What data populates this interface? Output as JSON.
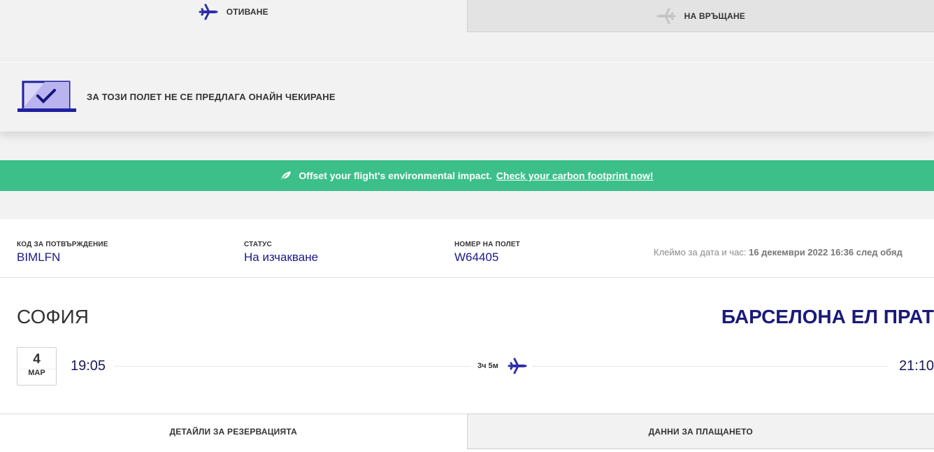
{
  "tabs": {
    "outbound": {
      "label": "ОТИВАНЕ",
      "icon": "plane-icon"
    },
    "return": {
      "label": "НА ВРЪЩАНЕ",
      "icon": "plane-icon"
    }
  },
  "checkin": {
    "message": "ЗА ТОЗИ ПОЛЕТ НЕ СЕ ПРЕДЛАГА ОНАЙН ЧЕКИРАНЕ",
    "icon": "laptop-check-icon"
  },
  "banner": {
    "text": "Offset your flight's environmental impact.",
    "link": "Check your carbon footprint now!",
    "icon": "leaf-icon",
    "color": "#3dbf8a"
  },
  "booking": {
    "confirmation": {
      "label": "КОД ЗА ПОТВЪРЖДЕНИЕ",
      "value": "BIMLFN"
    },
    "status": {
      "label": "СТАТУС",
      "value": "На изчакване"
    },
    "flight_number": {
      "label": "НОМЕР НА ПОЛЕТ",
      "value": "W64405"
    },
    "timestamp": {
      "label": "Клеймо за дата и час:",
      "value": "16 декември 2022 16:36 след обяд"
    }
  },
  "route": {
    "from_city": "СОФИЯ",
    "to_city": "БАРСЕЛОНА ЕЛ ПРАТ",
    "date_day": "4",
    "date_month": "МАР",
    "departure_time": "19:05",
    "arrival_time": "21:10",
    "duration": "3ч 5м"
  },
  "bottom_tabs": {
    "reservation_details": "ДЕТАЙЛИ ЗА РЕЗЕРВАЦИЯТА",
    "payment_details": "ДАННИ ЗА ПЛАЩАНЕТО"
  },
  "colors": {
    "accent": "#1a1a8a",
    "plane": "#2e2ea8",
    "plane_inactive": "#c4c4c4"
  }
}
